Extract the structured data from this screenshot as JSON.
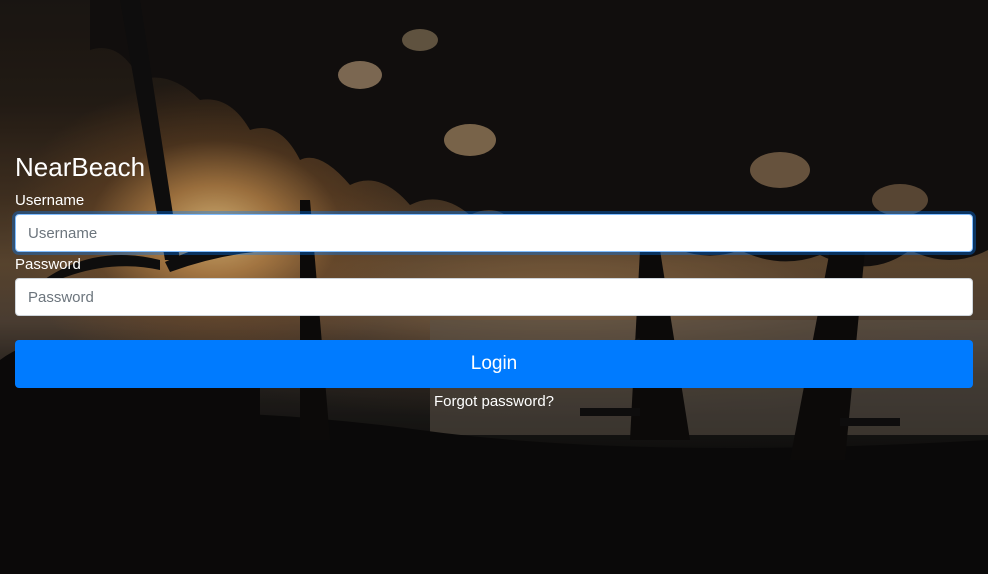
{
  "app": {
    "title": "NearBeach"
  },
  "login_form": {
    "username_label": "Username",
    "username_placeholder": "Username",
    "username_value": "",
    "password_label": "Password",
    "password_placeholder": "Password",
    "password_value": "",
    "login_button_label": "Login",
    "forgot_password_label": "Forgot password?"
  },
  "colors": {
    "primary_button": "#007bff",
    "focus_ring": "#80bdff",
    "text_on_background": "#ffffff"
  },
  "background": {
    "scene": "sunset-beach-silhouette"
  }
}
